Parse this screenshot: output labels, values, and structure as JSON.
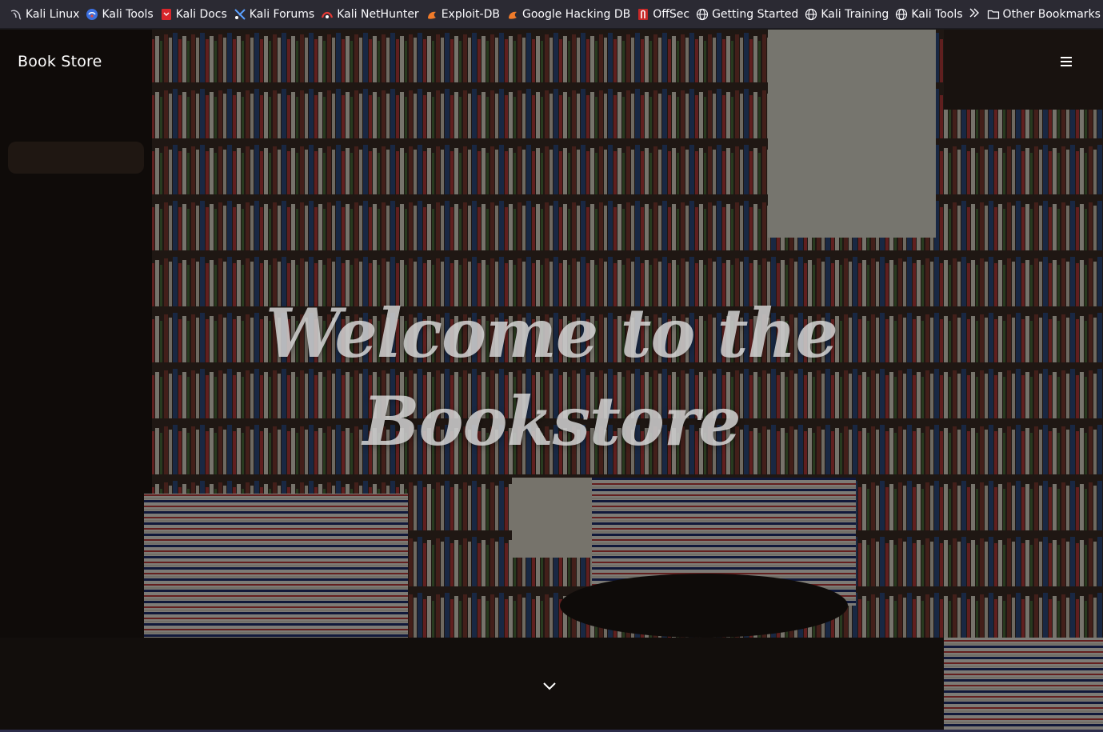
{
  "bookmarks": {
    "items": [
      {
        "label": "Kali Linux",
        "icon": "kali-dragon-icon"
      },
      {
        "label": "Kali Tools",
        "icon": "kali-tools-icon"
      },
      {
        "label": "Kali Docs",
        "icon": "kali-docs-icon"
      },
      {
        "label": "Kali Forums",
        "icon": "kali-forums-icon"
      },
      {
        "label": "Kali NetHunter",
        "icon": "nethunter-icon"
      },
      {
        "label": "Exploit-DB",
        "icon": "exploit-db-icon"
      },
      {
        "label": "Google Hacking DB",
        "icon": "ghdb-icon"
      },
      {
        "label": "OffSec",
        "icon": "offsec-icon"
      },
      {
        "label": "Getting Started",
        "icon": "globe-icon"
      },
      {
        "label": "Kali Training",
        "icon": "globe-icon"
      },
      {
        "label": "Kali Tools",
        "icon": "globe-icon"
      }
    ],
    "more_icon": "chevrons-right-icon",
    "other": {
      "label": "Other Bookmarks",
      "icon": "folder-icon"
    }
  },
  "site": {
    "brand": "Book Store",
    "menu_icon": "hamburger-icon",
    "hero_line1": "Welcome to the",
    "hero_line2": "Bookstore",
    "scroll_icon": "chevron-down-icon"
  },
  "colors": {
    "toolbar_bg": "#2b2a33",
    "toolbar_text": "#fbfbfe",
    "hero_text": "#dcdcdc",
    "brand_text": "#ffffff"
  }
}
